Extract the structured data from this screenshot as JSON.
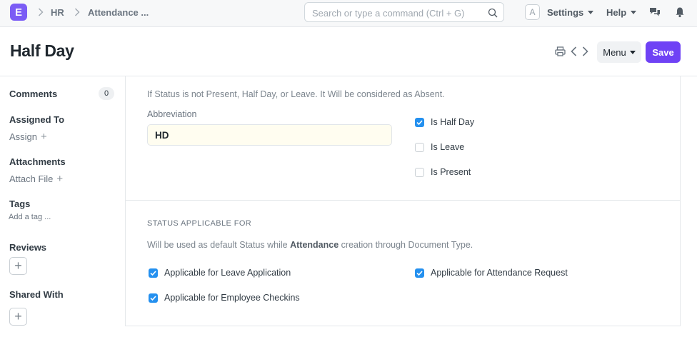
{
  "navbar": {
    "logo": "E",
    "breadcrumbs": [
      "HR",
      "Attendance ..."
    ],
    "search_placeholder": "Search or type a command (Ctrl + G)",
    "avatar_initial": "A",
    "settings_label": "Settings",
    "help_label": "Help"
  },
  "page": {
    "title": "Half Day",
    "menu_label": "Menu",
    "save_label": "Save"
  },
  "sidebar": {
    "comments_label": "Comments",
    "comments_count": "0",
    "assigned_to_label": "Assigned To",
    "assign_link": "Assign",
    "attachments_label": "Attachments",
    "attach_link": "Attach File",
    "tags_label": "Tags",
    "add_tag_link": "Add a tag ...",
    "reviews_label": "Reviews",
    "shared_with_label": "Shared With"
  },
  "form": {
    "status_note": "If Status is not Present, Half Day, or Leave. It Will be considered as Absent.",
    "abbreviation_label": "Abbreviation",
    "abbreviation_value": "HD",
    "checkboxes": [
      {
        "label": "Is Half Day",
        "checked": true
      },
      {
        "label": "Is Leave",
        "checked": false
      },
      {
        "label": "Is Present",
        "checked": false
      }
    ],
    "section_title": "STATUS APPLICABLE FOR",
    "section_desc_pre": "Will be used as default Status while ",
    "section_desc_bold": "Attendance",
    "section_desc_post": " creation through Document Type.",
    "applicable": [
      {
        "label": "Applicable for Leave Application",
        "checked": true
      },
      {
        "label": "Applicable for Attendance Request",
        "checked": true
      },
      {
        "label": "Applicable for Employee Checkins",
        "checked": true
      }
    ]
  },
  "colors": {
    "accent": "#6f42f5",
    "logo": "#7b5cf5",
    "checkbox_checked": "#2490ef"
  }
}
